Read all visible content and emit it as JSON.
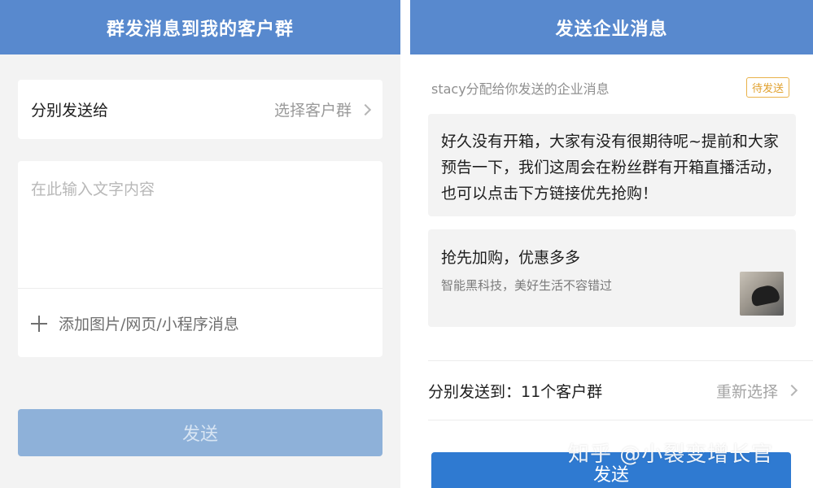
{
  "left": {
    "title": "群发消息到我的客户群",
    "send_to_label": "分别发送给",
    "select_group": "选择客户群",
    "text_placeholder": "在此输入文字内容",
    "add_attachment": "添加图片/网页/小程序消息",
    "send_button": "发送"
  },
  "right": {
    "title": "发送企业消息",
    "meta": "stacy分配给你发送的企业消息",
    "status_badge": "待发送",
    "message_text": "好久没有开箱，大家有没有很期待呢~提前和大家预告一下，我们这周会在粉丝群有开箱直播活动，也可以点击下方链接优先抢购！",
    "link_card": {
      "title": "抢先加购，优惠多多",
      "subtitle": "智能黑科技，美好生活不容错过"
    },
    "target_label": "分别发送到：11个客户群",
    "reselect": "重新选择",
    "send_button": "发送"
  },
  "watermark": "知乎 @小裂变增长官",
  "colors": {
    "header": "#5889ce",
    "disabled_button": "#8eb1d9",
    "primary_button": "#2f7ad1",
    "badge": "#e0a02d"
  }
}
